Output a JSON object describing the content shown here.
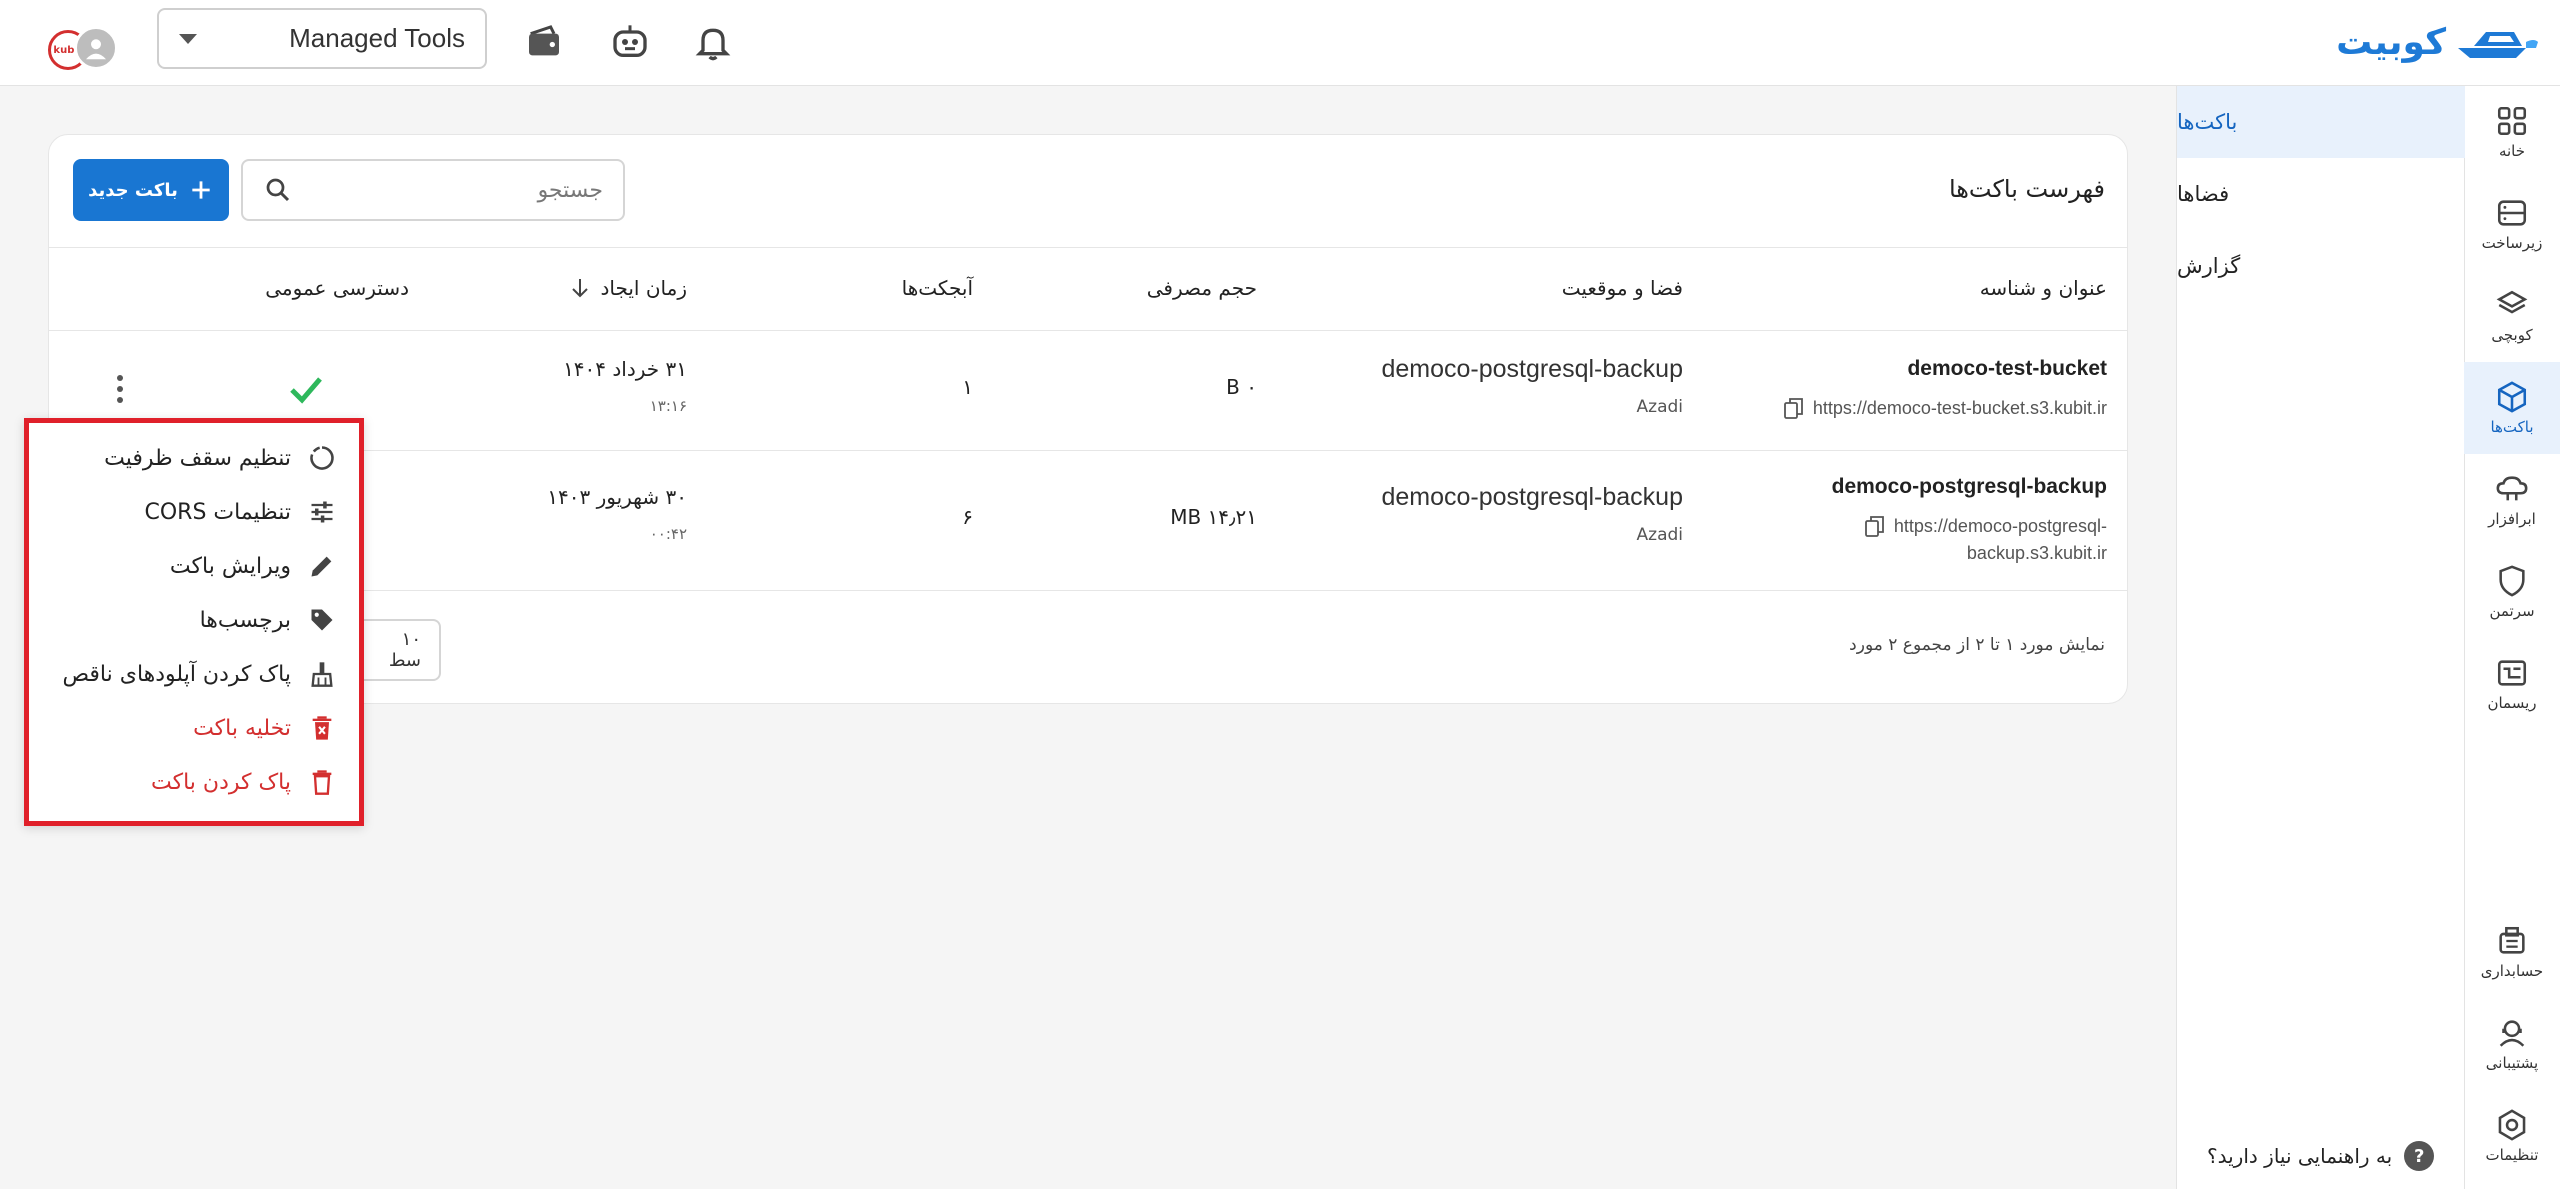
{
  "brand": {
    "name": "کوبیت"
  },
  "topbar": {
    "account": "Managed Tools",
    "avatar_badge": "kubit",
    "icons": [
      "wallet-icon",
      "robot-icon",
      "bell-icon"
    ]
  },
  "rail": {
    "items": [
      {
        "label": "خانه",
        "icon": "grid-icon"
      },
      {
        "label": "زیرساخت",
        "icon": "server-icon"
      },
      {
        "label": "کوبچی",
        "icon": "layers-icon"
      },
      {
        "label": "باکت‌ها",
        "icon": "cube-icon",
        "active": true
      },
      {
        "label": "ابرافزار",
        "icon": "cloud-icon"
      },
      {
        "label": "سرتمن",
        "icon": "shield-icon"
      },
      {
        "label": "ریسمان",
        "icon": "pipeline-icon"
      }
    ],
    "bottom_items": [
      {
        "label": "حسابداری",
        "icon": "accounting-icon"
      },
      {
        "label": "پشتیبانی",
        "icon": "support-icon"
      },
      {
        "label": "تنظیمات",
        "icon": "settings-icon"
      }
    ]
  },
  "subnav": {
    "items": [
      {
        "label": "باکت‌ها",
        "active": true
      },
      {
        "label": "فضاها"
      },
      {
        "label": "گزارش"
      }
    ],
    "help": "به راهنمایی نیاز دارید؟"
  },
  "card": {
    "title": "فهرست باکت‌ها",
    "new_button": "باکت جدید",
    "search_placeholder": "جستجو",
    "columns": {
      "name": "عنوان و شناسه",
      "space": "فضا و موقعیت",
      "size": "حجم مصرفی",
      "objects": "آبجکت‌ها",
      "created": "زمان ایجاد",
      "public": "دسترسی عمومی"
    },
    "rows": [
      {
        "name": "democo-test-bucket",
        "url_line1": "https://democo-test-bucket.s3.kubit.ir",
        "url_line2": "",
        "space": "democo-postgresql-backup",
        "location": "Azadi",
        "size": "۰ B",
        "objects": "۱",
        "created_date": "۳۱ خرداد ۱۴۰۴",
        "created_time": "۱۳:۱۶",
        "public": true
      },
      {
        "name": "democo-postgresql-backup",
        "url_line1": "https://democo-postgresql-",
        "url_line2": "backup.s3.kubit.ir",
        "space": "democo-postgresql-backup",
        "location": "Azadi",
        "size": "۱۴٫۲۱ MB",
        "objects": "۶",
        "created_date": "۳۰ شهریور ۱۴۰۳",
        "created_time": "۰۰:۴۲",
        "public": false
      }
    ],
    "footer": "نمایش مورد ۱ تا ۲ از مجموع ۲ مورد",
    "rows_per_page": "۱۰ سط"
  },
  "context_menu": {
    "items": [
      {
        "label": "تنظیم سقف ظرفیت",
        "icon": "quota-icon"
      },
      {
        "label": "تنظیمات CORS",
        "icon": "sliders-icon"
      },
      {
        "label": "ویرایش باکت",
        "icon": "pencil-icon"
      },
      {
        "label": "برچسب‌ها",
        "icon": "tag-icon"
      },
      {
        "label": "پاک کردن آپلودهای ناقص",
        "icon": "broom-icon"
      },
      {
        "label": "تخلیه باکت",
        "icon": "empty-bucket-icon",
        "danger": true
      },
      {
        "label": "پاک کردن باکت",
        "icon": "trash-icon",
        "danger": true
      }
    ]
  },
  "colors": {
    "primary": "#1976d2",
    "danger": "#d32f2f",
    "success": "#2eb85c",
    "highlight_border": "#e0202a"
  }
}
